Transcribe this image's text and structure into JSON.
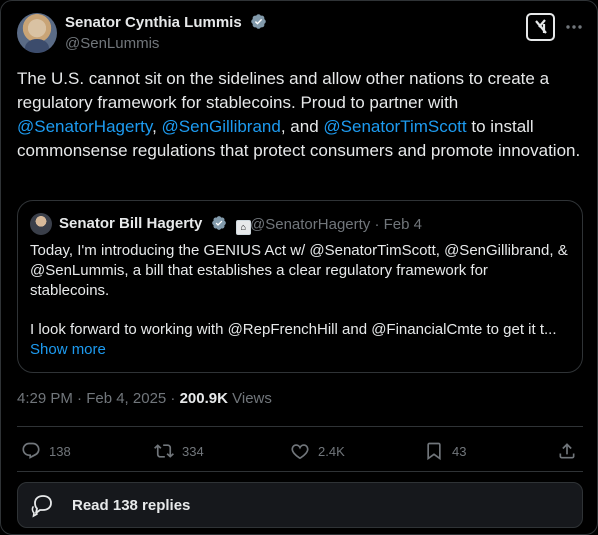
{
  "author": {
    "name": "Senator Cynthia Lummis",
    "handle": "@SenLummis"
  },
  "tweet": {
    "part1": "The U.S. cannot sit on the sidelines and allow other nations to create a regulatory framework for stablecoins. Proud to partner with ",
    "mention1": "@SenatorHagerty",
    "sep1": ", ",
    "mention2": "@SenGillibrand",
    "sep2": ", and ",
    "mention3": "@SenatorTimScott",
    "part2": " to install commonsense regulations that protect consumers and promote innovation."
  },
  "quote": {
    "name": "Senator Bill Hagerty",
    "meta": "@SenatorHagerty · Feb 4",
    "para1": "Today, I'm introducing the GENIUS Act w/ @SenatorTimScott, @SenGillibrand, & @SenLummis, a bill that establishes a clear regulatory framework for stablecoins.",
    "para2": "I look forward to working with @RepFrenchHill and @FinancialCmte to get it t...",
    "show_more": "Show more"
  },
  "meta": {
    "time_date": "4:29 PM · Feb 4, 2025 · ",
    "views_count": "200.9K",
    "views_label": " Views"
  },
  "actions": {
    "replies": "138",
    "reposts": "334",
    "likes": "2.4K",
    "bookmarks": "43"
  },
  "read_replies": "Read 138 replies",
  "colors": {
    "accent": "#1d9bf0",
    "muted": "#71767b",
    "background": "#000000",
    "border": "#2f3336"
  }
}
